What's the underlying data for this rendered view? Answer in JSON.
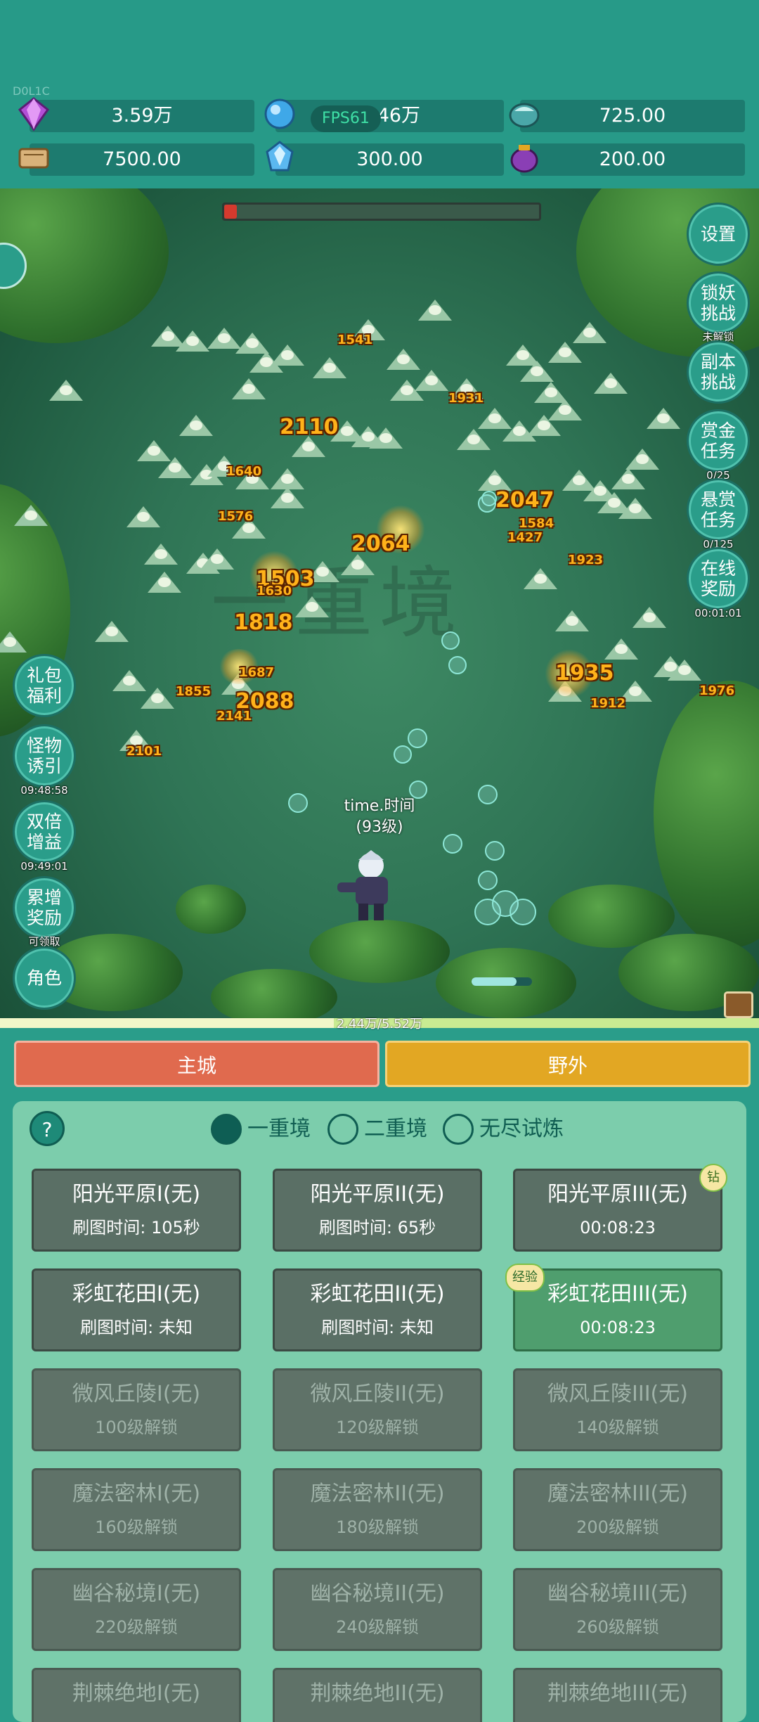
{
  "build_tag": "D0L1C",
  "fps": "FPS61",
  "resources": [
    {
      "icon": "purple-gem-icon",
      "value": "3.59万"
    },
    {
      "icon": "blue-crystal-icon",
      "value": "1.46万"
    },
    {
      "icon": "teal-ore-icon",
      "value": "725.00"
    },
    {
      "icon": "scroll-icon",
      "value": "7500.00"
    },
    {
      "icon": "ice-crystal-icon",
      "value": "300.00"
    },
    {
      "icon": "purple-pot-icon",
      "value": "200.00"
    }
  ],
  "battle": {
    "watermark": "一重境",
    "boss_hp_fraction": 0.04,
    "hero_name": "time.时间",
    "hero_level": "(93级)",
    "damage_numbers": [
      "1541",
      "1931",
      "2110",
      "1640",
      "1576",
      "2047",
      "1584",
      "1427",
      "2064",
      "1503",
      "1630",
      "1923",
      "1818",
      "1935",
      "1855",
      "1687",
      "2088",
      "1912",
      "1976",
      "2101",
      "2141"
    ]
  },
  "right_buttons": [
    {
      "label": "设置",
      "sub": ""
    },
    {
      "label": "锁妖挑战",
      "sub": "未解锁"
    },
    {
      "label": "副本挑战",
      "sub": ""
    },
    {
      "label": "赏金任务",
      "sub": "0/25"
    },
    {
      "label": "悬赏任务",
      "sub": "0/125"
    },
    {
      "label": "在线奖励",
      "sub": "00:01:01"
    }
  ],
  "left_buttons": [
    {
      "label": "礼包福利",
      "sub": ""
    },
    {
      "label": "怪物诱引",
      "sub": "09:48:58"
    },
    {
      "label": "双倍增益",
      "sub": "09:49:01"
    },
    {
      "label": "累增奖励",
      "sub": "可领取"
    },
    {
      "label": "角色",
      "sub": ""
    }
  ],
  "exp": {
    "text": "2.44万/5.52万",
    "fraction": 0.44
  },
  "tabs": {
    "city": "主城",
    "wild": "野外"
  },
  "panel": {
    "help": "?",
    "realms": [
      {
        "label": "一重境",
        "selected": true
      },
      {
        "label": "二重境",
        "selected": false
      },
      {
        "label": "无尽试炼",
        "selected": false
      }
    ],
    "maps": [
      {
        "name": "阳光平原I(无)",
        "status": "刷图时间: 105秒",
        "state": "unlocked",
        "badge": ""
      },
      {
        "name": "阳光平原II(无)",
        "status": "刷图时间: 65秒",
        "state": "unlocked",
        "badge": ""
      },
      {
        "name": "阳光平原III(无)",
        "status": "00:08:23",
        "state": "unlocked",
        "badge": "钻"
      },
      {
        "name": "彩虹花田I(无)",
        "status": "刷图时间: 未知",
        "state": "unlocked",
        "badge": ""
      },
      {
        "name": "彩虹花田II(无)",
        "status": "刷图时间: 未知",
        "state": "unlocked",
        "badge": ""
      },
      {
        "name": "彩虹花田III(无)",
        "status": "00:08:23",
        "state": "active",
        "badge": "经验"
      },
      {
        "name": "微风丘陵I(无)",
        "status": "100级解锁",
        "state": "locked",
        "badge": ""
      },
      {
        "name": "微风丘陵II(无)",
        "status": "120级解锁",
        "state": "locked",
        "badge": ""
      },
      {
        "name": "微风丘陵III(无)",
        "status": "140级解锁",
        "state": "locked",
        "badge": ""
      },
      {
        "name": "魔法密林I(无)",
        "status": "160级解锁",
        "state": "locked",
        "badge": ""
      },
      {
        "name": "魔法密林II(无)",
        "status": "180级解锁",
        "state": "locked",
        "badge": ""
      },
      {
        "name": "魔法密林III(无)",
        "status": "200级解锁",
        "state": "locked",
        "badge": ""
      },
      {
        "name": "幽谷秘境I(无)",
        "status": "220级解锁",
        "state": "locked",
        "badge": ""
      },
      {
        "name": "幽谷秘境II(无)",
        "status": "240级解锁",
        "state": "locked",
        "badge": ""
      },
      {
        "name": "幽谷秘境III(无)",
        "status": "260级解锁",
        "state": "locked",
        "badge": ""
      },
      {
        "name": "荆棘绝地I(无)",
        "status": "",
        "state": "locked",
        "badge": ""
      },
      {
        "name": "荆棘绝地II(无)",
        "status": "",
        "state": "locked",
        "badge": ""
      },
      {
        "name": "荆棘绝地III(无)",
        "status": "",
        "state": "locked",
        "badge": ""
      }
    ]
  }
}
